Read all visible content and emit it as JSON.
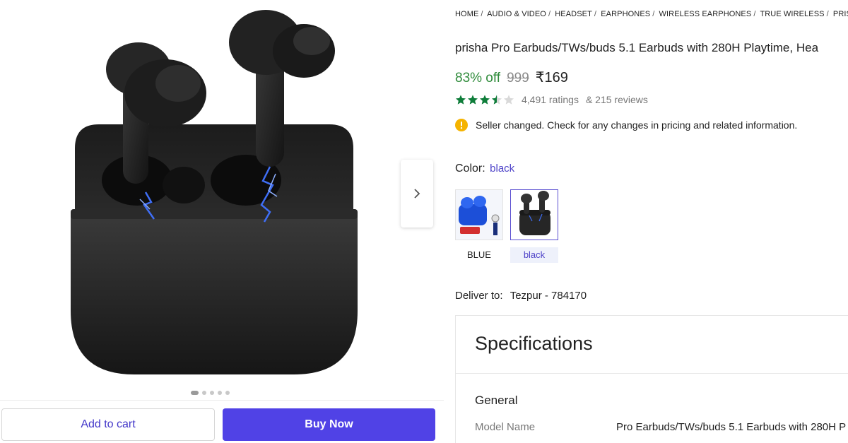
{
  "breadcrumb": [
    "HOME",
    "AUDIO & VIDEO",
    "HEADSET",
    "EARPHONES",
    "WIRELESS EARPHONES",
    "TRUE WIRELESS",
    "PRISHA T"
  ],
  "product": {
    "title": "prisha Pro Earbuds/TWs/buds 5.1 Earbuds with 280H Playtime, Hea",
    "discount": "83% off",
    "mrp": "999",
    "price": "₹169",
    "rating": 3.5,
    "ratings_text": "4,491 ratings",
    "reviews_text": "& 215 reviews"
  },
  "notice": {
    "icon": "info-icon",
    "color": "#f5b300",
    "text": "Seller changed. Check for any changes in pricing and related information."
  },
  "color": {
    "label": "Color:",
    "selected": "black",
    "options": [
      {
        "label": "BLUE"
      },
      {
        "label": "black"
      }
    ]
  },
  "delivery": {
    "label": "Deliver to:",
    "place": "Tezpur - 784170"
  },
  "actions": {
    "add_to_cart": "Add to cart",
    "buy_now": "Buy Now"
  },
  "gallery": {
    "image_count": 5,
    "active_index": 0
  },
  "specifications": {
    "heading": "Specifications",
    "section": "General",
    "rows": [
      {
        "key": "Model Name",
        "value": "Pro Earbuds/TWs/buds 5.1 Earbuds with 280H P"
      }
    ]
  },
  "colors": {
    "accent": "#5042e6",
    "discount": "#2e8b3a",
    "link": "#4f44c9"
  }
}
